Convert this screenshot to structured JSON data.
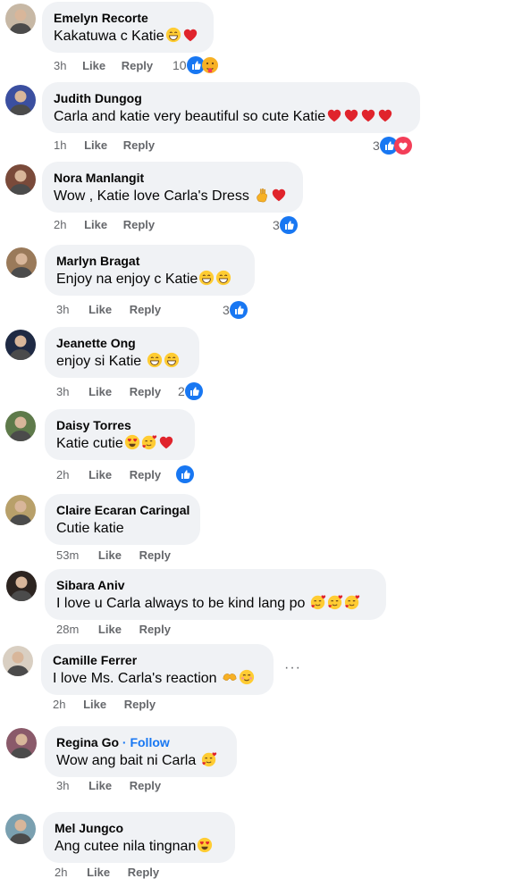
{
  "comments": [
    {
      "author": "Emelyn Recorte",
      "text": "Kakatuwa c Katie",
      "time": "3h",
      "like": "Like",
      "reply": "Reply",
      "reaction_count": "10"
    },
    {
      "author": "Judith Dungog",
      "text": "Carla and katie very beautiful so cute Katie",
      "time": "1h",
      "like": "Like",
      "reply": "Reply",
      "reaction_count": "3"
    },
    {
      "author": "Nora Manlangit",
      "text": "Wow , Katie love Carla's Dress",
      "time": "2h",
      "like": "Like",
      "reply": "Reply",
      "reaction_count": "3"
    },
    {
      "author": "Marlyn Bragat",
      "text": "Enjoy na enjoy c Katie",
      "time": "3h",
      "like": "Like",
      "reply": "Reply",
      "reaction_count": "3"
    },
    {
      "author": "Jeanette Ong",
      "text": "enjoy si Katie",
      "time": "3h",
      "like": "Like",
      "reply": "Reply",
      "reaction_count": "2"
    },
    {
      "author": "Daisy Torres",
      "text": "Katie cutie",
      "time": "2h",
      "like": "Like",
      "reply": "Reply",
      "reaction_count": ""
    },
    {
      "author": "Claire Ecaran Caringal",
      "text": "Cutie katie",
      "time": "53m",
      "like": "Like",
      "reply": "Reply"
    },
    {
      "author": "Sibara Aniv",
      "text": "I love u Carla always to be kind lang po",
      "time": "28m",
      "like": "Like",
      "reply": "Reply"
    },
    {
      "author": "Camille Ferrer",
      "text": "I love Ms. Carla's reaction",
      "time": "2h",
      "like": "Like",
      "reply": "Reply",
      "more": "···"
    },
    {
      "author": "Regina Go",
      "follow": "· Follow",
      "text": "Wow ang bait ni Carla",
      "time": "3h",
      "like": "Like",
      "reply": "Reply"
    },
    {
      "author": "Mel Jungco",
      "text": "Ang cutee nila tingnan",
      "time": "2h",
      "like": "Like",
      "reply": "Reply"
    }
  ],
  "icons": {
    "like": "like-reaction-icon",
    "love": "love-reaction-icon",
    "care": "care-reaction-icon"
  },
  "colors": {
    "bubble": "#f0f2f5",
    "like_blue": "#1877f2",
    "love_red": "#f33e58",
    "meta_gray": "#65676b"
  }
}
